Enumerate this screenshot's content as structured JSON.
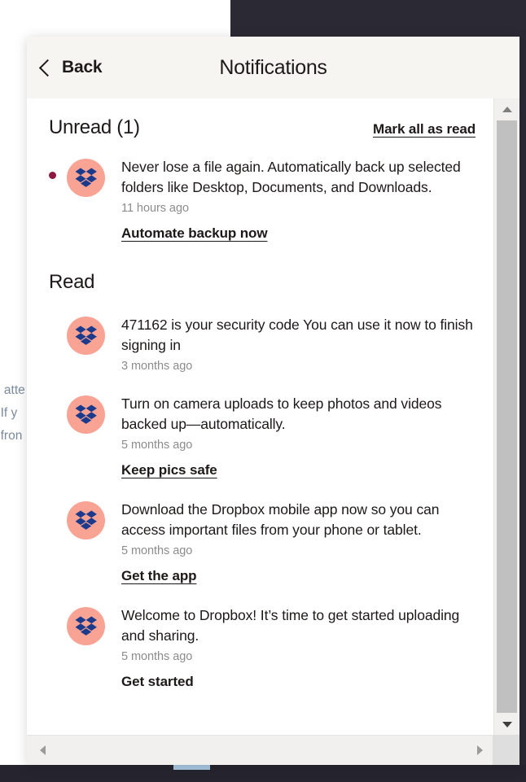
{
  "background": {
    "clipped_text_lines": [
      "e atte",
      ". If y",
      "t fron"
    ]
  },
  "panel": {
    "header": {
      "back_label": "Back",
      "title": "Notifications",
      "back_icon": "chevron-left-icon"
    },
    "unread_section": {
      "title": "Unread (1)",
      "mark_all_label": "Mark all as read",
      "items": [
        {
          "avatar_icon": "dropbox-logo-icon",
          "unread": true,
          "text": "Never lose a file again. Automatically back up selected folders like Desktop, Documents, and Downloads.",
          "time": "11 hours ago",
          "cta": "Automate backup now"
        }
      ]
    },
    "read_section": {
      "title": "Read",
      "items": [
        {
          "avatar_icon": "dropbox-logo-icon",
          "unread": false,
          "text": "471162 is your security code You can use it now to finish signing in",
          "time": "3 months ago",
          "cta": ""
        },
        {
          "avatar_icon": "dropbox-logo-icon",
          "unread": false,
          "text": "Turn on camera uploads to keep photos and videos backed up—automatically.",
          "time": "5 months ago",
          "cta": "Keep pics safe"
        },
        {
          "avatar_icon": "dropbox-logo-icon",
          "unread": false,
          "text": "Download the Dropbox mobile app now so you can access important files from your phone or tablet.",
          "time": "5 months ago",
          "cta": "Get the app"
        },
        {
          "avatar_icon": "dropbox-logo-icon",
          "unread": false,
          "text": "Welcome to Dropbox! It’s time to get started uploading and sharing.",
          "time": "5 months ago",
          "cta": "Get started"
        }
      ]
    },
    "scrollbars": {
      "vertical_up_icon": "caret-up-icon",
      "vertical_down_icon": "caret-down-icon",
      "horizontal_left_icon": "caret-left-icon",
      "horizontal_right_icon": "caret-right-icon"
    }
  },
  "colors": {
    "avatar_bg": "#f9a394",
    "dropbox_logo": "#1b3a8c",
    "unread_dot": "#8f1742",
    "header_bg": "#f7f5f2",
    "text_primary": "#1e1919",
    "text_muted": "#8c8c8c",
    "desktop_dark": "#2b2933"
  }
}
